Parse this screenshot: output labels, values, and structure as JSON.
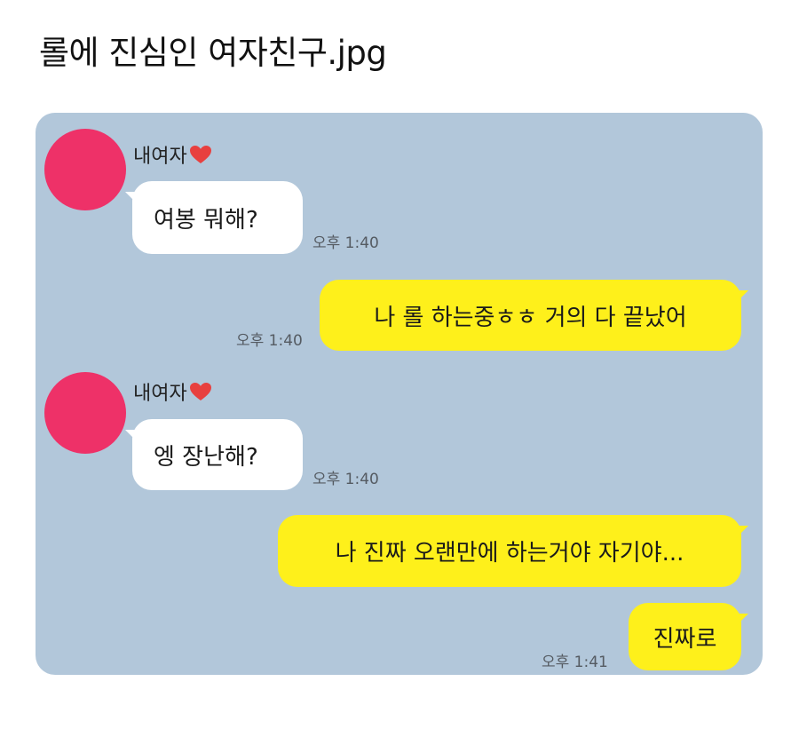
{
  "post": {
    "title": "롤에 진심인 여자친구.jpg"
  },
  "chat": {
    "background_color": "#b2c7da",
    "incoming_bubble_color": "#ffffff",
    "outgoing_bubble_color": "#fef01b",
    "avatar_color": "#ee3168",
    "contact_name": "내여자",
    "messages": [
      {
        "direction": "incoming",
        "sender": "내여자",
        "text": "여봉 뭐해?",
        "time": "오후 1:40"
      },
      {
        "direction": "outgoing",
        "text": "나 롤 하는중ㅎㅎ 거의 다 끝났어",
        "time": "오후 1:40"
      },
      {
        "direction": "incoming",
        "sender": "내여자",
        "text": "엥 장난해?",
        "time": "오후 1:40"
      },
      {
        "direction": "outgoing",
        "text": "나 진짜 오랜만에 하는거야 자기야...",
        "time": ""
      },
      {
        "direction": "outgoing",
        "text": "진짜로",
        "time": "오후 1:41"
      }
    ]
  }
}
